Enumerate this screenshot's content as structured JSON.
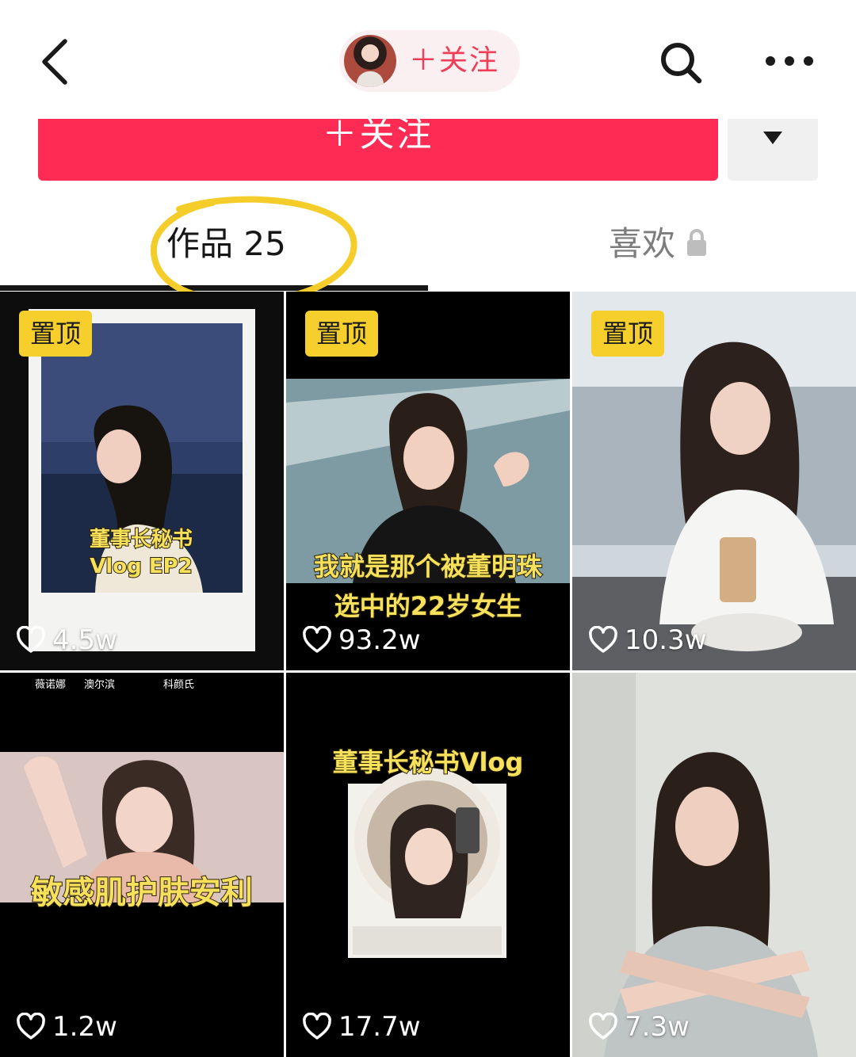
{
  "header": {
    "follow_label": "＋关注",
    "icons": {
      "back": "chevron-left-icon",
      "search": "search-icon",
      "more": "more-dots-icon"
    }
  },
  "follow": {
    "label": "＋关注",
    "dropdown_icon": "caret-down-icon"
  },
  "tabs": {
    "works": "作品 25",
    "likes": "喜欢",
    "likes_icon": "lock-icon"
  },
  "colors": {
    "accent": "#fe2c55",
    "pin_badge": "#f6cf2c",
    "annotation": "#f5cd2a"
  },
  "videos": [
    {
      "pinned": "置顶",
      "caption": [
        "董事长秘书",
        "Vlog EP2"
      ],
      "likes": "4.5w"
    },
    {
      "pinned": "置顶",
      "caption": [
        "我就是那个被董明珠",
        "选中的22岁女生"
      ],
      "likes": "93.2w"
    },
    {
      "pinned": "置顶",
      "likes": "10.3w"
    },
    {
      "caption": [
        "敏感肌护肤安利"
      ],
      "likes": "1.2w",
      "top_labels": [
        "薇诺娜",
        "澳尔滨",
        "科颜氏"
      ]
    },
    {
      "caption": [
        "董事长秘书Vlog"
      ],
      "likes": "17.7w"
    },
    {
      "likes": "7.3w"
    }
  ]
}
